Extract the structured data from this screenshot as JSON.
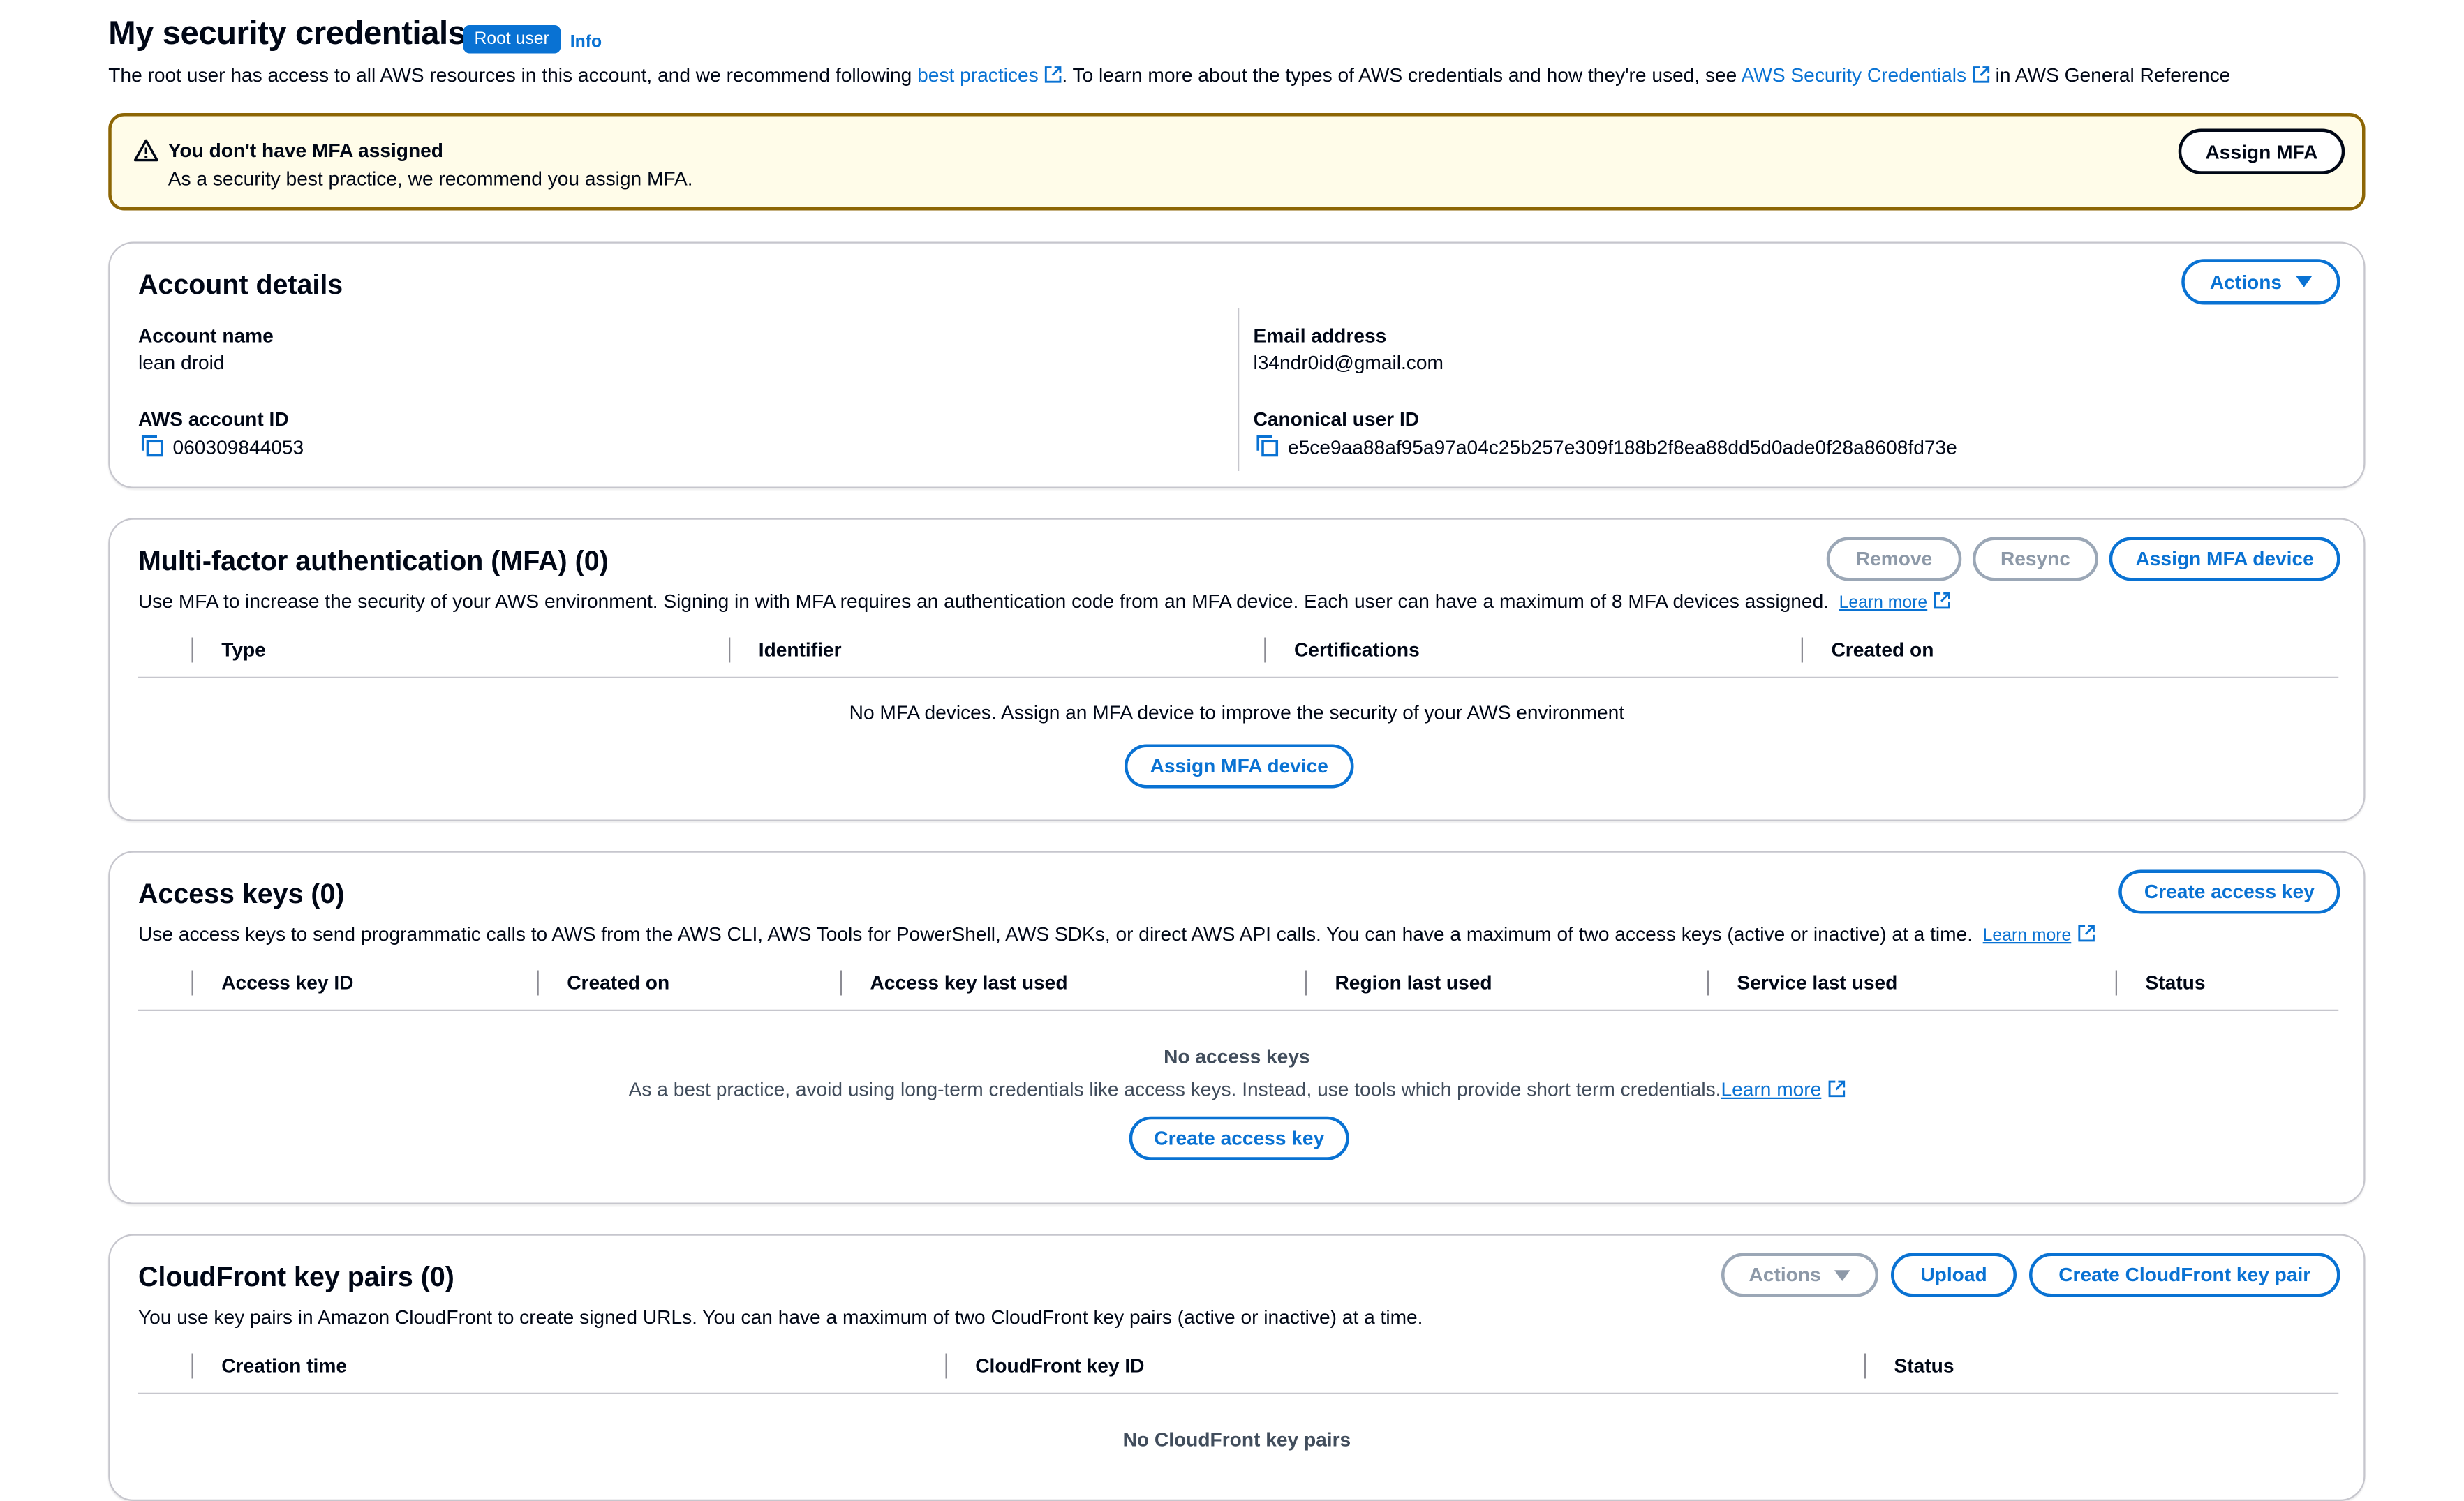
{
  "header": {
    "title": "My security credentials",
    "badge": "Root user",
    "info": "Info",
    "subtitle_prefix": "The root user has access to all AWS resources in this account, and we recommend following ",
    "best_practices_link": "best practices",
    "subtitle_middle": ". To learn more about the types of AWS credentials and how they're used, see ",
    "aws_credentials_link": "AWS Security Credentials",
    "subtitle_suffix": " in AWS General Reference"
  },
  "alert": {
    "heading": "You don't have MFA assigned",
    "body": "As a security best practice, we recommend you assign MFA.",
    "button": "Assign MFA"
  },
  "account": {
    "title": "Account details",
    "actions_button": "Actions",
    "account_name_label": "Account name",
    "account_name": "lean droid",
    "account_id_label": "AWS account ID",
    "account_id": "060309844053",
    "email_label": "Email address",
    "email": "l34ndr0id@gmail.com",
    "canonical_label": "Canonical user ID",
    "canonical_id": "e5ce9aa88af95a97a04c25b257e309f188b2f8ea88dd5d0ade0f28a8608fd73e"
  },
  "mfa": {
    "title": "Multi-factor authentication (MFA) (0)",
    "remove_button": "Remove",
    "resync_button": "Resync",
    "assign_button": "Assign MFA device",
    "description": "Use MFA to increase the security of your AWS environment. Signing in with MFA requires an authentication code from an MFA device. Each user can have a maximum of 8 MFA devices assigned.",
    "learn_more": "Learn more",
    "columns": [
      "Type",
      "Identifier",
      "Certifications",
      "Created on"
    ],
    "empty_text": "No MFA devices. Assign an MFA device to improve the security of your AWS environment",
    "empty_button": "Assign MFA device"
  },
  "access_keys": {
    "title": "Access keys (0)",
    "create_button": "Create access key",
    "description": "Use access keys to send programmatic calls to AWS from the AWS CLI, AWS Tools for PowerShell, AWS SDKs, or direct AWS API calls. You can have a maximum of two access keys (active or inactive) at a time.",
    "learn_more": "Learn more",
    "columns": [
      "Access key ID",
      "Created on",
      "Access key last used",
      "Region last used",
      "Service last used",
      "Status"
    ],
    "empty_title": "No access keys",
    "empty_text": "As a best practice, avoid using long-term credentials like access keys. Instead, use tools which provide short term credentials.",
    "empty_learn_more": "Learn more",
    "empty_button": "Create access key"
  },
  "cloudfront": {
    "title": "CloudFront key pairs (0)",
    "actions_button": "Actions",
    "upload_button": "Upload",
    "create_button": "Create CloudFront key pair",
    "description": "You use key pairs in Amazon CloudFront to create signed URLs. You can have a maximum of two CloudFront key pairs (active or inactive) at a time.",
    "columns": [
      "Creation time",
      "CloudFront key ID",
      "Status"
    ],
    "empty_title": "No CloudFront key pairs"
  },
  "icons": {
    "external_link": "external-link-icon",
    "warning": "warning-icon",
    "copy": "copy-icon",
    "caret": "caret-down-icon"
  },
  "colors": {
    "link": "#0972d3",
    "warning_border": "#8d6605",
    "warning_bg": "#fffce9",
    "text": "#000716"
  }
}
